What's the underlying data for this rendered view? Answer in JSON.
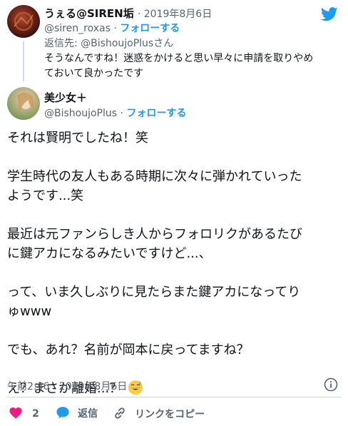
{
  "reply_tweet": {
    "author_name": "うぇる@SIREN垢",
    "handle": "@siren_roxas",
    "date": "2019年8月6日",
    "follow_label": "フォローする",
    "replying_to_label": "返信先: ",
    "replying_to_handle": "@BishoujoPlus",
    "replying_to_suffix": "さん",
    "text_lines": [
      "そうなんですね！迷惑をかけると思い早々に申請を取りやめ",
      "ておいて良かったです"
    ]
  },
  "main_tweet": {
    "author_name": "美少女＋",
    "handle": "@BishoujoPlus",
    "follow_label": "フォローする",
    "text_lines": [
      "それは賢明でしたね！笑",
      "",
      "学生時代の友人もある時期に次々に弾かれていった",
      "ようです...笑",
      "",
      "最近は元ファンらしき人からフォロリクがあるたび",
      "に鍵アカになるみたいですけど...、",
      "",
      "って、いま久しぶりに見たらまた鍵アカになってり",
      "ゅwww",
      "",
      "でも、あれ？名前が岡本に戻ってますね？",
      "",
      "え？まさか離婚...？"
    ],
    "timestamp": "午前2:46 · 2019年8月6日"
  },
  "actions": {
    "like_count": "2",
    "reply_label": "返信",
    "copy_link_label": "リンクをコピー"
  },
  "colors": {
    "accent": "#1d9bf0",
    "like": "#f91880",
    "text": "#0f1419",
    "muted": "#536471"
  },
  "icons": [
    "twitter-bird-icon",
    "info-icon",
    "heart-icon",
    "reply-bubble-icon",
    "link-icon",
    "sweat-smile-emoji"
  ]
}
